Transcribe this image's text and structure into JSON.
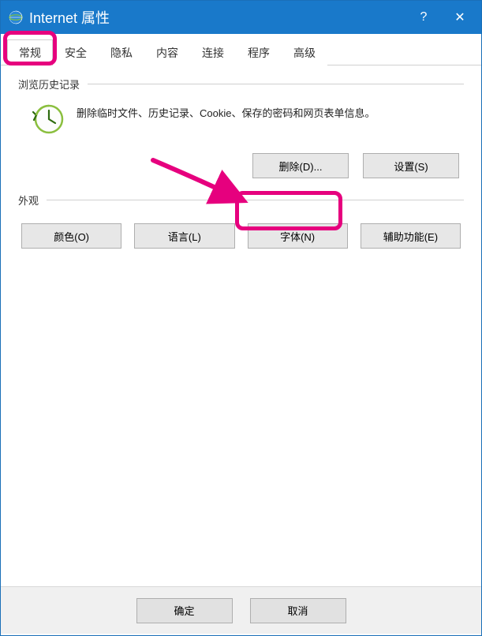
{
  "titlebar": {
    "title": "Internet 属性",
    "help": "?",
    "close": "✕"
  },
  "tabs": {
    "general": "常规",
    "security": "安全",
    "privacy": "隐私",
    "content": "内容",
    "connections": "连接",
    "programs": "程序",
    "advanced": "高级"
  },
  "sections": {
    "history": {
      "label": "浏览历史记录",
      "description": "删除临时文件、历史记录、Cookie、保存的密码和网页表单信息。",
      "delete": "删除(D)...",
      "settings": "设置(S)"
    },
    "appearance": {
      "label": "外观",
      "colors": "颜色(O)",
      "languages": "语言(L)",
      "fonts": "字体(N)",
      "accessibility": "辅助功能(E)"
    }
  },
  "footer": {
    "ok": "确定",
    "cancel": "取消"
  }
}
